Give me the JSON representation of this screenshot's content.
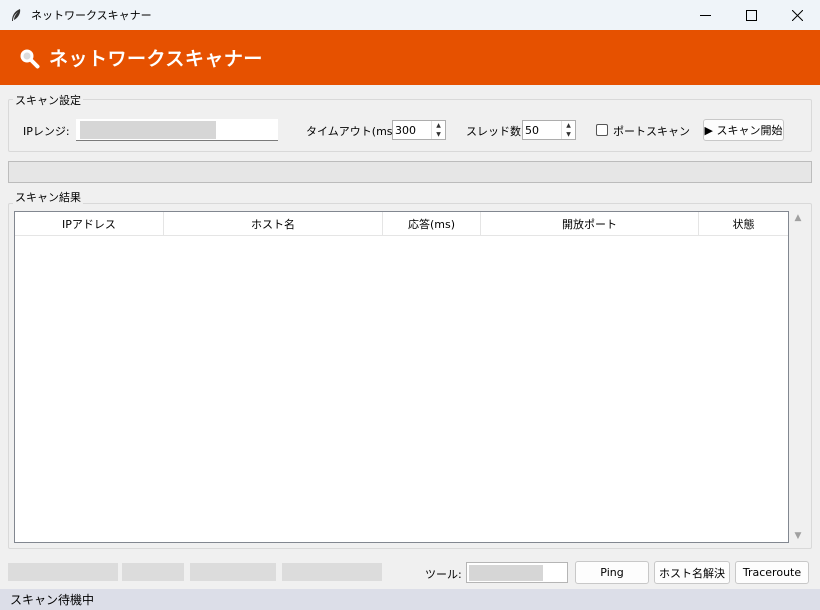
{
  "window": {
    "title": "ネットワークスキャナー"
  },
  "header": {
    "title": "ネットワークスキャナー",
    "icon": "magnifier-icon",
    "color": "#e65100"
  },
  "settings": {
    "group_label": "スキャン設定",
    "ip_range_label": "IPレンジ:",
    "ip_range_value": "",
    "timeout_label": "タイムアウト(ms):",
    "timeout_value": "300",
    "threads_label": "スレッド数:",
    "threads_value": "50",
    "port_scan_label": "ポートスキャン",
    "port_scan_checked": false,
    "start_button": "▶ スキャン開始"
  },
  "progress": {
    "value": 0
  },
  "results": {
    "group_label": "スキャン結果",
    "columns": [
      "IPアドレス",
      "ホスト名",
      "応答(ms)",
      "開放ポート",
      "状態"
    ],
    "rows": []
  },
  "tools": {
    "label": "ツール:",
    "input_value": "",
    "ping_button": "Ping",
    "resolve_button": "ホスト名解決",
    "traceroute_button": "Traceroute"
  },
  "status": {
    "text": "スキャン待機中"
  }
}
